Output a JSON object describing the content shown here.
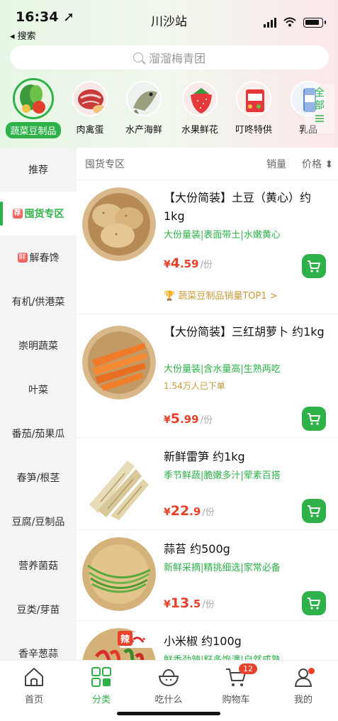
{
  "status_bar": {
    "time": "16:34 ➚",
    "back_label": "◂ 搜索",
    "station": "川沙站"
  },
  "search": {
    "placeholder": "溜溜梅青团"
  },
  "categories": [
    {
      "label": "蔬菜豆制品",
      "active": true
    },
    {
      "label": "肉禽蛋"
    },
    {
      "label": "水产海鲜"
    },
    {
      "label": "水果鲜花"
    },
    {
      "label": "叮咚特供"
    },
    {
      "label": "乳品"
    }
  ],
  "all_categories": {
    "label": "全部"
  },
  "sidebar": [
    {
      "label": "推荐"
    },
    {
      "label": "囤货专区",
      "tag": "荐",
      "active": true
    },
    {
      "label": "解春馋",
      "tag": "鲜"
    },
    {
      "label": "有机/供港菜"
    },
    {
      "label": "崇明蔬菜"
    },
    {
      "label": "叶菜"
    },
    {
      "label": "番茄/茄果瓜"
    },
    {
      "label": "春笋/根茎"
    },
    {
      "label": "豆腐/豆制品"
    },
    {
      "label": "营养菌菇"
    },
    {
      "label": "豆类/芽苗"
    },
    {
      "label": "香辛葱蒜"
    }
  ],
  "filter": {
    "section": "囤货专区",
    "sales": "销量",
    "price": "价格 ⬍"
  },
  "products": [
    {
      "name": "【大份简装】土豆（黄心）约1kg",
      "tags": "大份量装|表面带土|水嫩黄心",
      "price_int": "4",
      "price_dec": ".59",
      "unit": "/份",
      "top_label": "🏆 蔬菜豆制品销量TOP1 >"
    },
    {
      "name": "【大份简装】三红胡萝卜 约1kg",
      "tags": "大份量装|含水量高|生熟两吃",
      "sold": "1.54万人已下单",
      "price_int": "5",
      "price_dec": ".99",
      "unit": "/份"
    },
    {
      "name": "新鲜雷笋 约1kg",
      "tags": "季节鲜蔬|脆嫩多汁|荤素百搭",
      "price_int": "22",
      "price_dec": ".9",
      "unit": "/份"
    },
    {
      "name": "蒜苔 约500g",
      "tags": "新鲜采摘|精挑细选|家常必备",
      "price_int": "13",
      "price_dec": ".5",
      "unit": "/份"
    },
    {
      "name": "小米椒 约100g",
      "tags": "鲜香劲辣|籽多饱满|自然成熟",
      "badge": "辣"
    }
  ],
  "currency": "¥",
  "tabs": [
    {
      "label": "首页"
    },
    {
      "label": "分类",
      "active": true
    },
    {
      "label": "吃什么"
    },
    {
      "label": "购物车",
      "badge": "12"
    },
    {
      "label": "我的"
    }
  ]
}
